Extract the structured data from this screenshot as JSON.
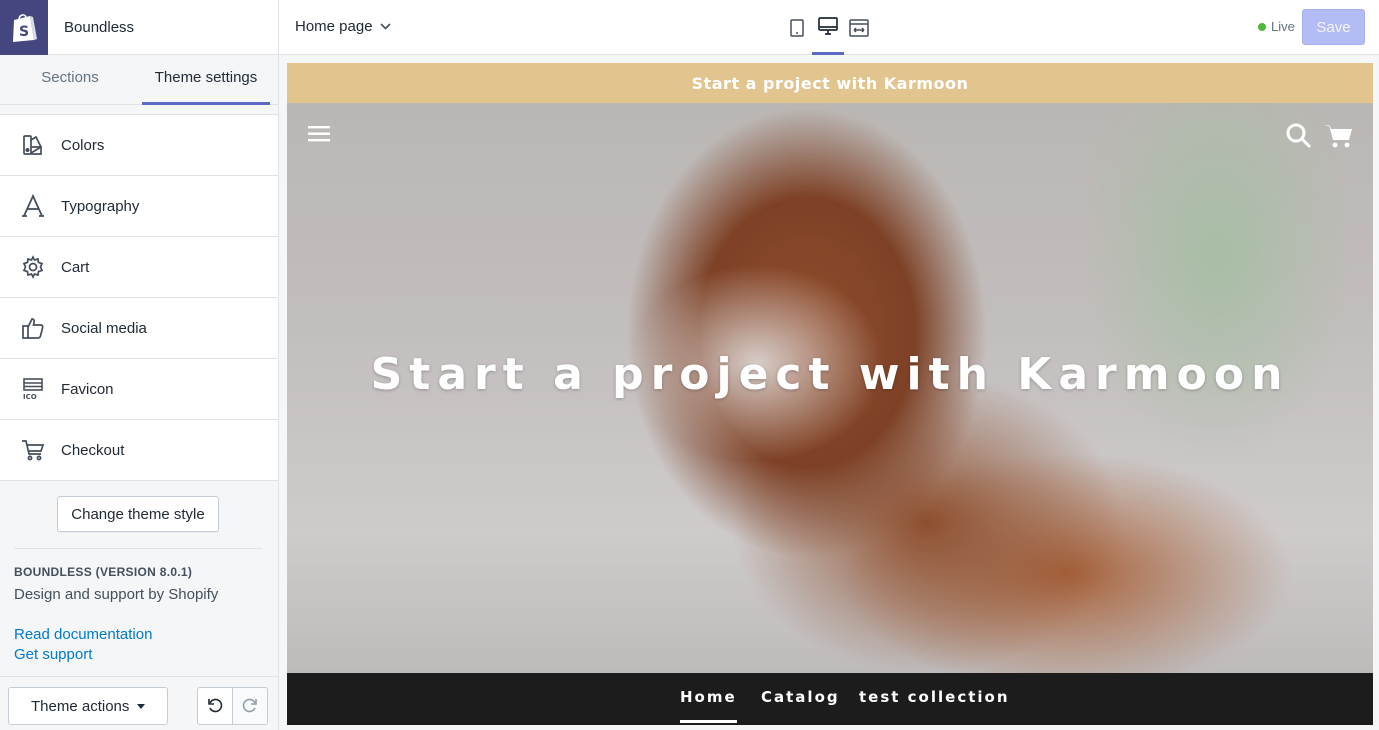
{
  "sidebar": {
    "theme_name": "Boundless",
    "tabs": [
      {
        "label": "Sections"
      },
      {
        "label": "Theme settings"
      }
    ],
    "items": [
      {
        "label": "Colors",
        "icon": "colors-icon"
      },
      {
        "label": "Typography",
        "icon": "typography-icon"
      },
      {
        "label": "Cart",
        "icon": "gear-icon"
      },
      {
        "label": "Social media",
        "icon": "thumbs-up-icon"
      },
      {
        "label": "Favicon",
        "icon": "favicon-icon"
      },
      {
        "label": "Checkout",
        "icon": "cart-icon"
      }
    ],
    "change_style_label": "Change theme style",
    "version": "BOUNDLESS (VERSION 8.0.1)",
    "support_by": "Design and support by Shopify",
    "links": {
      "docs": "Read documentation",
      "support": "Get support"
    },
    "footer": {
      "theme_actions_label": "Theme actions"
    }
  },
  "topbar": {
    "page_select": "Home page",
    "live_label": "Live",
    "save_label": "Save"
  },
  "preview": {
    "announcement": "Start a project with Karmoon",
    "hero_title": "Start a project with Karmoon",
    "nav": [
      {
        "label": "Home"
      },
      {
        "label": "Catalog"
      },
      {
        "label": "test collection"
      }
    ]
  },
  "colors": {
    "accent": "#5c6ac4",
    "logo_bg": "#43467f",
    "announcement_bg": "#e2c48f",
    "nav_bg": "#1c1c1c",
    "live": "#50b83c",
    "save_disabled": "#b3bcf5",
    "link": "#007ace"
  }
}
